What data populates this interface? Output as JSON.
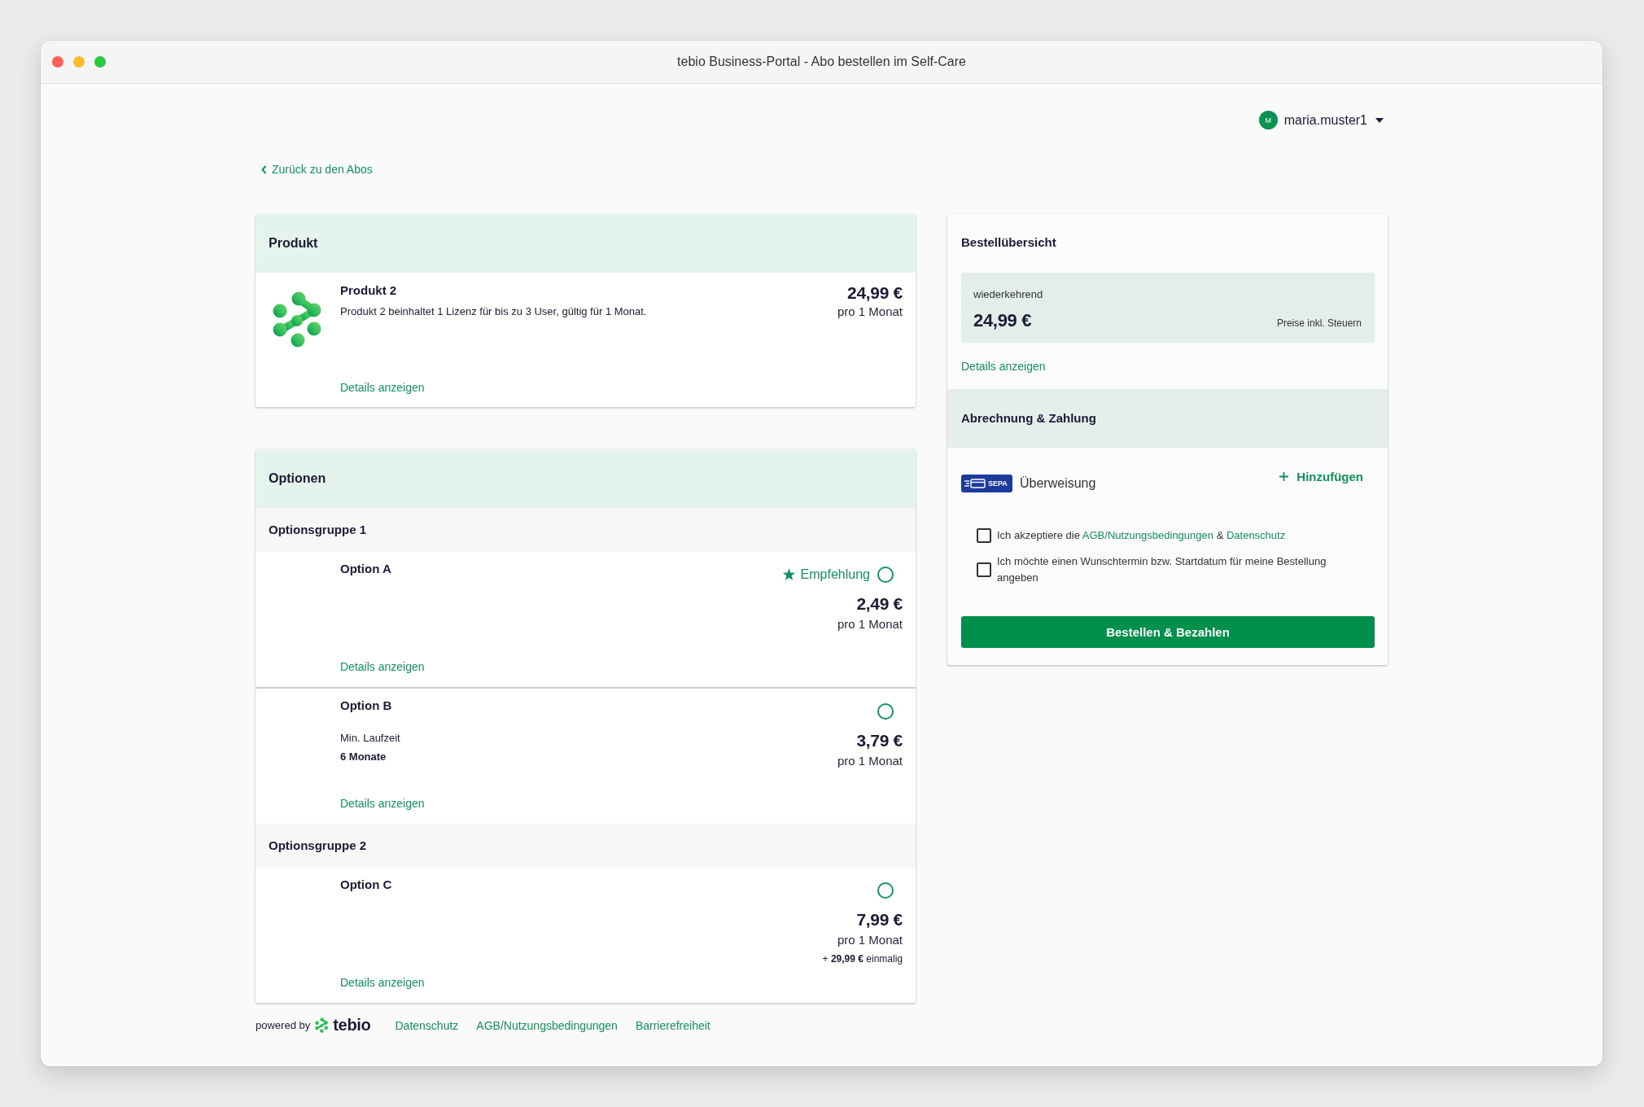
{
  "window": {
    "title": "tebio Business-Portal - Abo bestellen im Self-Care"
  },
  "user_menu": {
    "avatar_initial": "M",
    "username": "maria.muster1"
  },
  "back_link": "Zurück zu den Abos",
  "product_card": {
    "title": "Produkt",
    "item": {
      "name": "Produkt 2",
      "description": "Produkt 2 beinhaltet 1 Lizenz für bis zu 3 User, gültig für 1 Monat.",
      "price": "24,99 €",
      "period": "pro 1 Monat",
      "details_link": "Details anzeigen"
    }
  },
  "options_card": {
    "title": "Optionen",
    "groups": [
      {
        "title": "Optionsgruppe 1",
        "options": [
          {
            "name": "Option A",
            "badge": "Empfehlung",
            "selected": false,
            "price": "2,49 €",
            "period": "pro 1 Monat",
            "details_link": "Details anzeigen"
          },
          {
            "name": "Option B",
            "min_term_label": "Min. Laufzeit",
            "min_term": "6 Monate",
            "selected": false,
            "price": "3,79 €",
            "period": "pro 1 Monat",
            "details_link": "Details anzeigen"
          }
        ]
      },
      {
        "title": "Optionsgruppe 2",
        "options": [
          {
            "name": "Option C",
            "selected": false,
            "price": "7,99 €",
            "period": "pro 1 Monat",
            "one_time_fee": "+ **29,99 €** einmalig",
            "details_link": "Details anzeigen"
          }
        ]
      }
    ]
  },
  "order_summary": {
    "title": "Bestellübersicht",
    "recurring_label": "wiederkehrend",
    "total": "24,99 €",
    "tax_note": "Preise inkl. Steuern",
    "details_link": "Details anzeigen"
  },
  "billing": {
    "title": "Abrechnung & Zahlung",
    "payment_method": {
      "logo_text": "SEPA",
      "name": "Überweisung"
    },
    "add_button": "Hinzufügen",
    "consents": [
      {
        "checked": false,
        "parts": [
          {
            "kind": "text",
            "text": "Ich akzeptiere die"
          },
          {
            "kind": "link",
            "text": "AGB/Nutzungsbedingungen"
          },
          {
            "kind": "text",
            "text": "&"
          },
          {
            "kind": "link",
            "text": "Datenschutz"
          }
        ]
      },
      {
        "checked": false,
        "parts": [
          {
            "kind": "text",
            "text": "Ich möchte einen Wunschtermin bzw. Startdatum für meine Bestellung angeben"
          }
        ]
      }
    ],
    "submit_button": "Bestellen & Bezahlen"
  },
  "footer": {
    "powered_by": "powered by",
    "brand": "tebio",
    "links": [
      "Datenschutz",
      "AGB/Nutzungsbedingungen",
      "Barrierefreiheit"
    ]
  }
}
